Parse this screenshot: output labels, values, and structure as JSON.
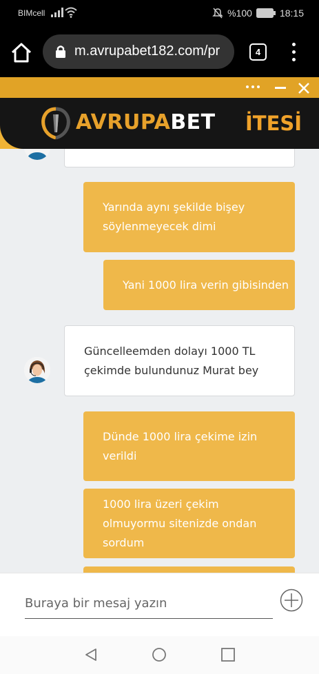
{
  "status_bar": {
    "carrier": "BIMcell",
    "battery": "%100",
    "time": "18:15"
  },
  "browser": {
    "url": "m.avrupabet182.com/pr",
    "tab_count": "4"
  },
  "banner": {
    "brand_part1": "AVRUPA",
    "brand_part2": "BET",
    "right_text": "İTESİ"
  },
  "messages": [
    {
      "from": "user",
      "text": "Yarında aynı şekilde bişey söylenmeyecek dimi"
    },
    {
      "from": "user",
      "text": "Yani 1000 lira verin gibisinden"
    },
    {
      "from": "agent",
      "text": "Güncelleemden dolayı 1000 TL çekimde bulundunuz Murat bey"
    },
    {
      "from": "user",
      "text": "Dünde 1000 lira çekime izin verildi"
    },
    {
      "from": "user",
      "text": "1000 lira üzeri çekim olmuyormu sitenizde ondan sordum"
    }
  ],
  "input": {
    "placeholder": "Buraya bir mesaj yazın"
  },
  "colors": {
    "accent": "#efb84a",
    "header": "#e1a326",
    "brand_dark": "#151515"
  }
}
